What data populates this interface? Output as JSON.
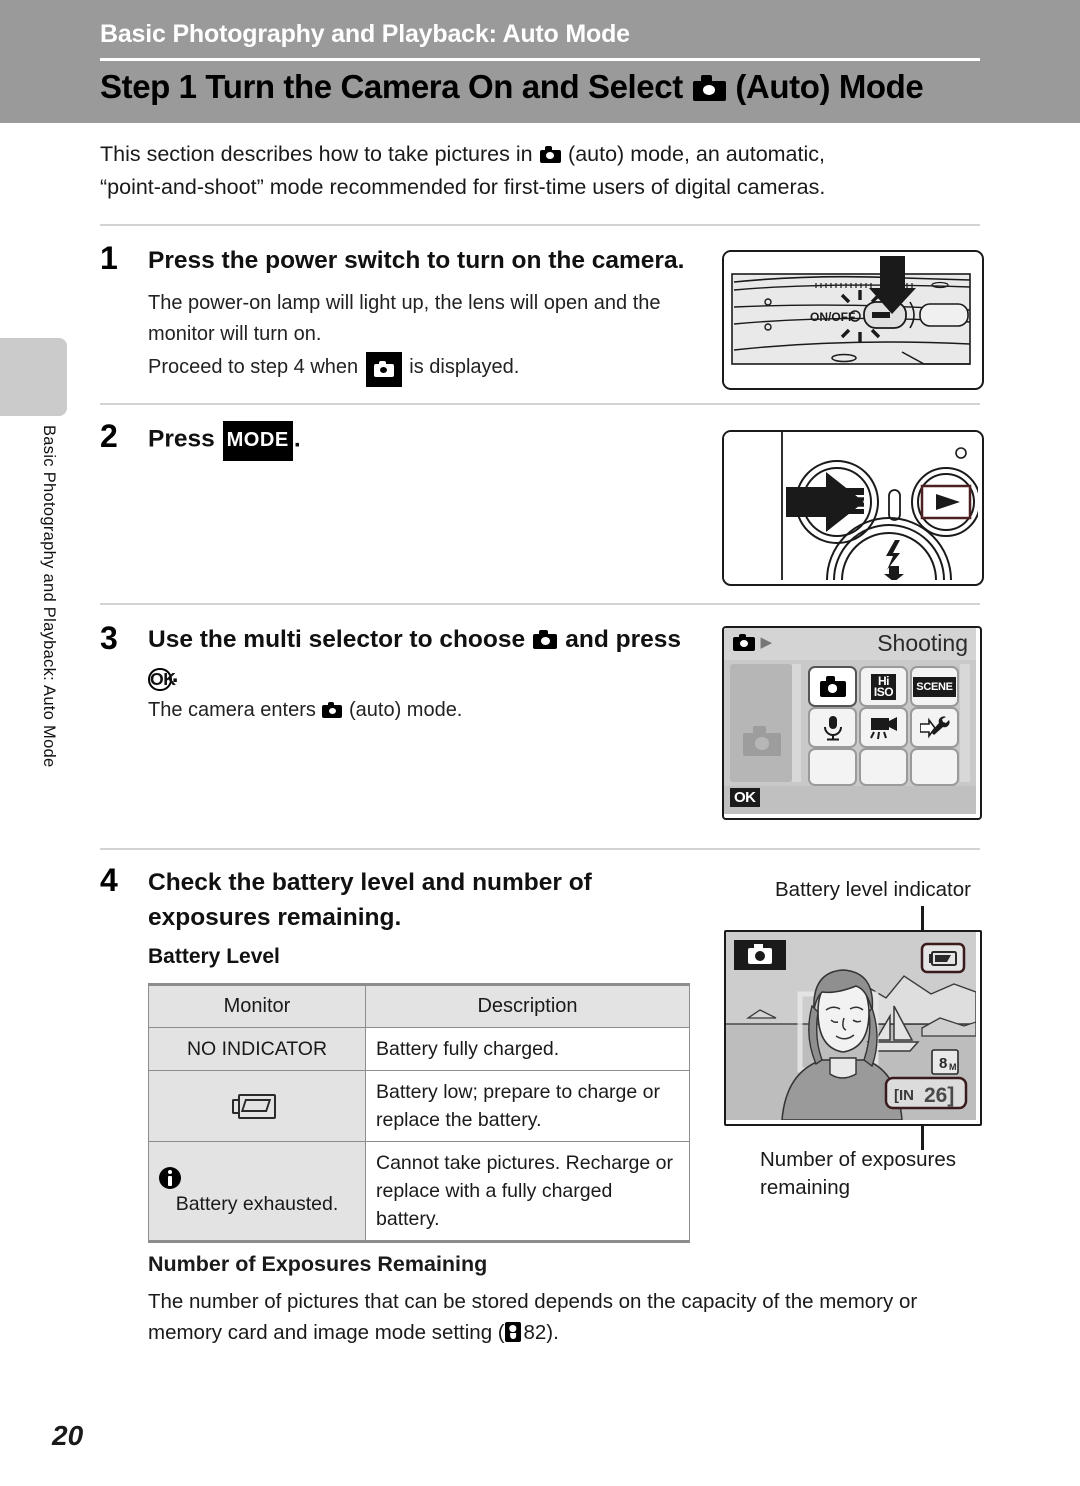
{
  "header": {
    "chapter": "Basic Photography and Playback: Auto Mode",
    "title_pre": "Step 1 Turn the Camera On and Select ",
    "title_post": " (Auto) Mode",
    "band_color": "#9a9a9a"
  },
  "side_tab_text": "Basic Photography and Playback: Auto Mode",
  "intro": {
    "line1_a": "This section describes how to take pictures in ",
    "line1_b": " (auto) mode, an automatic,",
    "line2": "“point-and-shoot” mode recommended for first-time users of digital cameras."
  },
  "steps": [
    {
      "number": "1",
      "heading": "Press the power switch to turn on the camera.",
      "body1": "The power-on lamp will light up, the lens will open and the monitor will turn on.",
      "body2_a": "Proceed to step 4 when ",
      "body2_b": " is displayed.",
      "illustration": {
        "name": "camera-top-power-switch",
        "onoff_label": "ON/OFF"
      }
    },
    {
      "number": "2",
      "heading_a": "Press ",
      "mode_key": "MODE",
      "heading_b": ".",
      "illustration": {
        "name": "camera-back-mode-button",
        "mode_label": "MODE",
        "playback_label": "▶",
        "flash_label": "⚡"
      }
    },
    {
      "number": "3",
      "heading_a": "Use the multi selector to choose ",
      "heading_b": " and press ",
      "ok_key": "OK",
      "heading_c": ".",
      "body_a": "The camera enters ",
      "body_b": " (auto) mode.",
      "illustration": {
        "name": "shooting-mode-menu",
        "title": "Shooting",
        "ok_badge": "OK",
        "tiles": [
          {
            "id": "auto-mode",
            "label": "",
            "icon": "camera-icon",
            "selected": true
          },
          {
            "id": "high-iso-mode",
            "label": "Hi ISO",
            "icon": "hi-iso-icon",
            "selected": false
          },
          {
            "id": "scene-mode",
            "label": "SCENE",
            "icon": "scene-icon",
            "selected": false
          },
          {
            "id": "voice-recording-mode",
            "label": "",
            "icon": "microphone-icon",
            "selected": false
          },
          {
            "id": "movie-mode",
            "label": "",
            "icon": "movie-camera-icon",
            "selected": false
          },
          {
            "id": "setup-mode",
            "label": "",
            "icon": "wrench-icon",
            "selected": false
          },
          {
            "id": "empty-1",
            "label": "",
            "icon": "",
            "selected": false
          },
          {
            "id": "empty-2",
            "label": "",
            "icon": "",
            "selected": false
          },
          {
            "id": "empty-3",
            "label": "",
            "icon": "",
            "selected": false
          }
        ]
      }
    },
    {
      "number": "4",
      "heading": "Check the battery level and number of exposures remaining.",
      "subheading": "Battery Level"
    }
  ],
  "battery_table": {
    "headers": [
      "Monitor",
      "Description"
    ],
    "rows": [
      {
        "monitor_text": "NO INDICATOR",
        "monitor_icon": "",
        "description": "Battery fully charged."
      },
      {
        "monitor_text": "",
        "monitor_icon": "low-battery-icon",
        "description": "Battery low; prepare to charge or replace the battery."
      },
      {
        "monitor_text": "Battery exhausted.",
        "monitor_icon": "warning-icon",
        "description": "Cannot take pictures. Recharge or replace with a fully charged battery."
      }
    ]
  },
  "monitor_diagram": {
    "callout_top": "Battery level indicator",
    "callout_bottom": "Number of exposures remaining",
    "image_mode_label": "8M",
    "storage_label": "IN",
    "exposures_remaining": "26"
  },
  "bottom": {
    "heading": "Number of Exposures Remaining",
    "text_a": "The number of pictures that can be stored depends on the capacity of the memory or memory card and image mode setting (",
    "ref_page": "82",
    "text_b": ")."
  },
  "page_number": "20"
}
